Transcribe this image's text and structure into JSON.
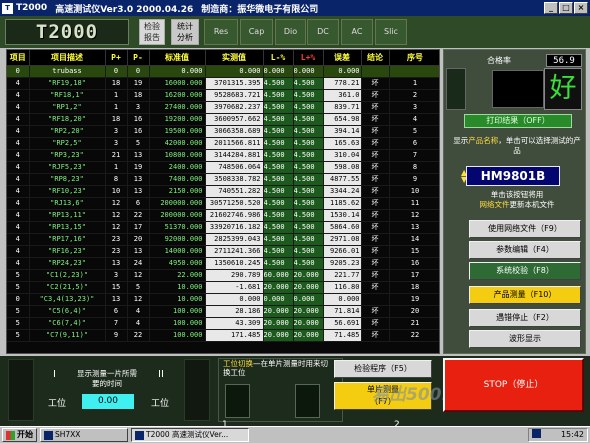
{
  "window": {
    "icon": "app-icon",
    "title_name": "T2000",
    "title_ver": "高速测试仪Ver3.0 2000.04.26",
    "title_mfr": "制造商：振华微电子有限公司"
  },
  "logo": "T2000",
  "tabs": [
    {
      "label": "检验\n报告"
    },
    {
      "label": "统计\n分析"
    },
    {
      "label": "Res"
    },
    {
      "label": "Cap"
    },
    {
      "label": "Dio"
    },
    {
      "label": "DC"
    },
    {
      "label": "AC"
    },
    {
      "label": "Slic"
    }
  ],
  "header_comment": "",
  "table": {
    "headers": [
      "项目",
      "项目描述",
      "P+",
      "P-",
      "标准值",
      "实测值",
      "L-%",
      "L+%",
      "误差",
      "结论",
      "序号"
    ],
    "rows": [
      [
        "0",
        "trubass",
        "0",
        "0",
        "0.000",
        "0.000",
        "0.000",
        "0.000",
        "0.000",
        "",
        ""
      ],
      [
        "4",
        "\"RF19,18\"",
        "18",
        "19",
        "16000.000",
        "3701315.395",
        "4.500",
        "4.500",
        "778.21",
        "坏",
        "1"
      ],
      [
        "4",
        "\"RF18,1\"",
        "1",
        "18",
        "16200.000",
        "9528683.721",
        "4.500",
        "4.500",
        "361.0",
        "坏",
        "2"
      ],
      [
        "4",
        "\"RP1,2\"",
        "1",
        "3",
        "27400.000",
        "3970682.237",
        "4.500",
        "4.500",
        "839.71",
        "坏",
        "3"
      ],
      [
        "4",
        "\"RF18,20\"",
        "18",
        "16",
        "19200.000",
        "3600957.662",
        "4.500",
        "4.500",
        "654.98",
        "坏",
        "4"
      ],
      [
        "4",
        "\"RP2,20\"",
        "3",
        "16",
        "19500.000",
        "3066358.689",
        "4.500",
        "4.500",
        "394.14",
        "坏",
        "5"
      ],
      [
        "4",
        "\"RP2,5\"",
        "3",
        "5",
        "42000.000",
        "2011566.811",
        "4.500",
        "4.500",
        "165.63",
        "坏",
        "6"
      ],
      [
        "4",
        "\"RP3,23\"",
        "21",
        "13",
        "10800.000",
        "3144284.881",
        "4.500",
        "4.500",
        "310.04",
        "坏",
        "7"
      ],
      [
        "4",
        "\"RJF5,23\"",
        "1",
        "19",
        "2400.000",
        "748506.064",
        "4.500",
        "4.500",
        "598.08",
        "坏",
        "8"
      ],
      [
        "4",
        "\"RP8,23\"",
        "8",
        "13",
        "7400.000",
        "3508338.782",
        "4.500",
        "4.500",
        "4877.55",
        "坏",
        "9"
      ],
      [
        "4",
        "\"RF10,23\"",
        "10",
        "13",
        "2150.000",
        "740551.282",
        "4.500",
        "4.500",
        "3344.24",
        "坏",
        "10"
      ],
      [
        "4",
        "\"RJ13,6\"",
        "12",
        "6",
        "200000.000",
        "30571250.520",
        "4.500",
        "4.500",
        "1185.62",
        "坏",
        "11"
      ],
      [
        "4",
        "\"RP13,11\"",
        "12",
        "22",
        "200000.000",
        "21602746.986",
        "4.500",
        "4.500",
        "1530.14",
        "坏",
        "12"
      ],
      [
        "4",
        "\"RP13,15\"",
        "12",
        "17",
        "51370.000",
        "33920716.182",
        "4.500",
        "4.500",
        "5864.60",
        "坏",
        "13"
      ],
      [
        "4",
        "\"RP17,16\"",
        "23",
        "20",
        "92000.000",
        "2825399.043",
        "4.500",
        "4.500",
        "2971.08",
        "坏",
        "14"
      ],
      [
        "4",
        "\"RF16,23\"",
        "23",
        "13",
        "14000.000",
        "2711241.366",
        "4.500",
        "4.500",
        "9266.01",
        "坏",
        "15"
      ],
      [
        "4",
        "\"RP24,23\"",
        "13",
        "24",
        "4950.000",
        "1350610.245",
        "4.500",
        "4.500",
        "9205.23",
        "坏",
        "16"
      ],
      [
        "5",
        "\"C1(2,23)\"",
        "3",
        "12",
        "22.000",
        "290.789",
        "60.000",
        "20.000",
        "221.77",
        "坏",
        "17"
      ],
      [
        "5",
        "\"C2(21,5)\"",
        "15",
        "5",
        "10.000",
        "-1.681",
        "20.000",
        "20.000",
        "116.80",
        "坏",
        "18"
      ],
      [
        "0",
        "\"C3,4(13,23)\"",
        "13",
        "12",
        "10.000",
        "0.000",
        "0.000",
        "0.000",
        "0.000",
        "",
        "19"
      ],
      [
        "5",
        "\"C5(6,4)\"",
        "6",
        "4",
        "100.000",
        "28.186",
        "20.000",
        "20.000",
        "71.814",
        "坏",
        "20"
      ],
      [
        "5",
        "\"C6(7,4)\"",
        "7",
        "4",
        "100.000",
        "43.309",
        "20.000",
        "20.000",
        "56.691",
        "坏",
        "21"
      ],
      [
        "5",
        "\"C7(9,11)\"",
        "9",
        "22",
        "100.000",
        "171.485",
        "20.000",
        "20.000",
        "71.485",
        "坏",
        "22"
      ]
    ]
  },
  "right": {
    "pass_label": "合格率",
    "pass_rate": "56.9",
    "good_glyph": "好",
    "print_button": "打印结果（OFF）",
    "product_note_a": "显示",
    "product_note_b": "产品名称",
    "product_note_c": "，单击可以选择测试的产品",
    "product_name": "HM9801B",
    "net_note_a": "单击该按钮将用",
    "net_note_b": "网络文件",
    "net_note_c": "更新本机文件",
    "buttons": [
      "使用网络文件（F9）",
      "参数编辑（F4）",
      "系统校验（F8）",
      "产品测量（F10）",
      "遇错停止（F2）",
      "波形显示"
    ]
  },
  "bottom": {
    "roman_1": "I",
    "roman_2": "II",
    "time_note": "显示测量一片所需要的时间",
    "station_left": "工位",
    "station_right": "工位",
    "time_value": "0.00",
    "switch_note_a": "工位切换",
    "switch_note_b": "—在单片测量时用来切换工位",
    "switch_1": "1",
    "switch_2": "2",
    "inspect_button": "检验程序（F5）",
    "single_button": "单片测量\n（F7）",
    "stop_button": "STOP（停止）",
    "watermark": "易出500.com"
  },
  "taskbar": {
    "start": "开始",
    "task1": "SH7XX",
    "task2": "T2000 高速测试仪Ver...",
    "time": "15:42"
  },
  "colors": {
    "accent": "#0a246a",
    "good": "#38e038",
    "stop": "#e82010",
    "yellow": "#f4cc10"
  }
}
